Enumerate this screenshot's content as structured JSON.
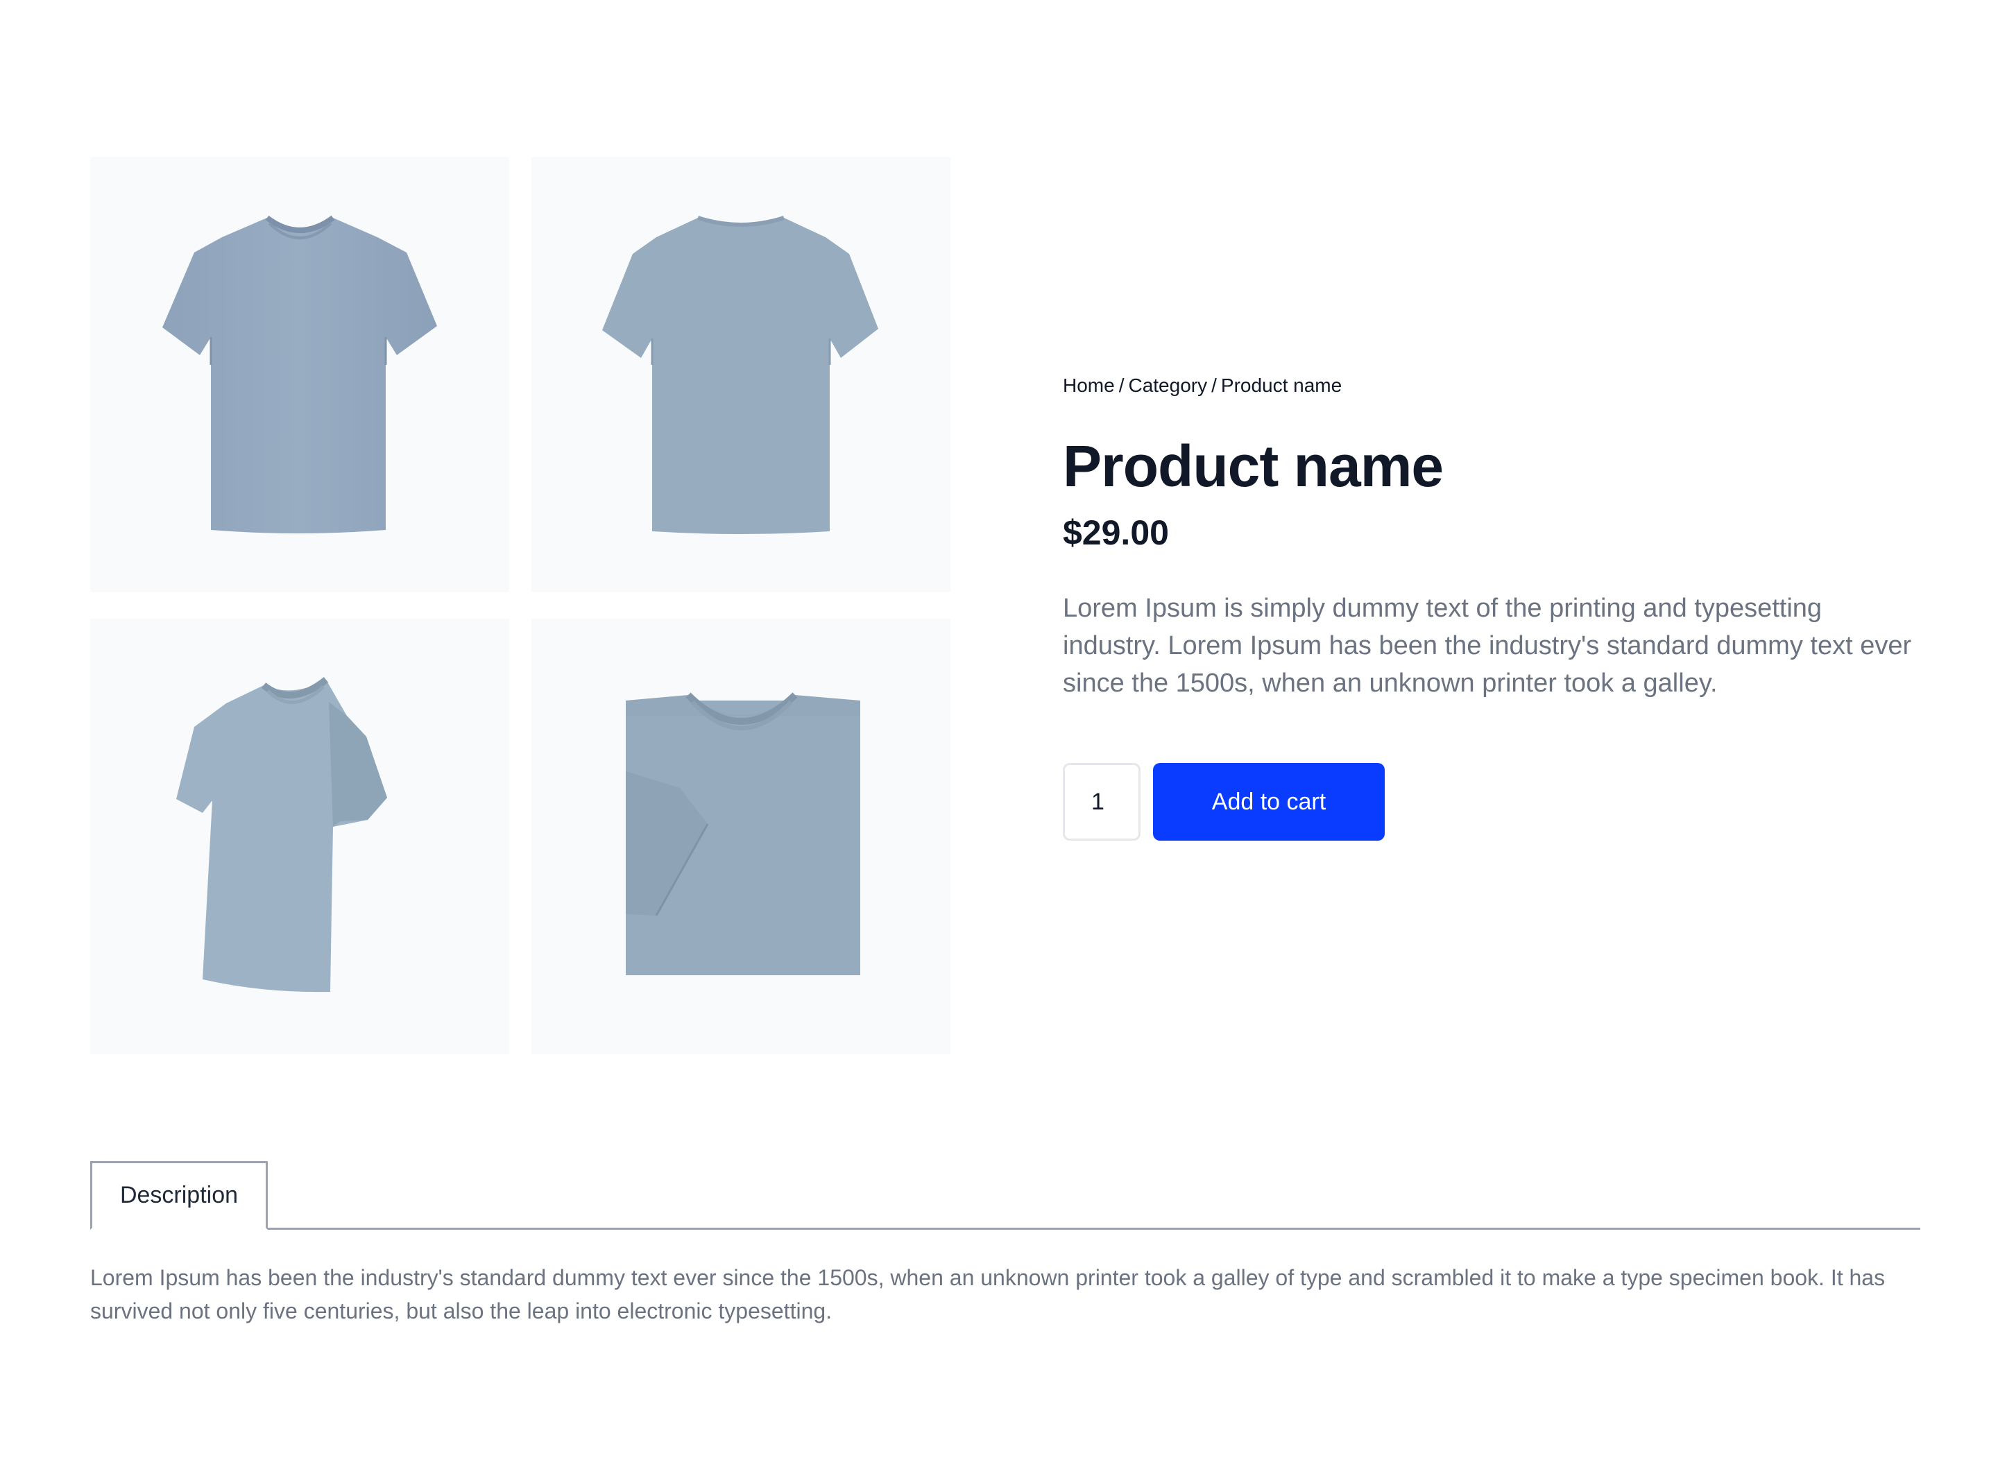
{
  "breadcrumb": {
    "home": "Home",
    "category": "Category",
    "product": "Product name",
    "separator": "/"
  },
  "product": {
    "title": "Product name",
    "price": "$29.00",
    "description": "Lorem Ipsum is simply dummy text of the printing and typesetting industry. Lorem Ipsum has been the industry's standard dummy text ever since the 1500s, when an unknown printer took a galley."
  },
  "cart": {
    "quantity": "1",
    "add_label": "Add to cart"
  },
  "gallery": {
    "images": [
      {
        "view": "front"
      },
      {
        "view": "back"
      },
      {
        "view": "angled"
      },
      {
        "view": "folded"
      }
    ]
  },
  "tabs": [
    {
      "label": "Description",
      "active": true
    }
  ],
  "tab_content": {
    "description": "Lorem Ipsum has been the industry's standard dummy text ever since the 1500s, when an unknown printer took a galley of type and scrambled it to make a type specimen book. It has survived not only five centuries, but also the leap into electronic typesetting."
  },
  "colors": {
    "accent": "#0a3cff",
    "shirt": "#94aac0",
    "thumb_bg": "#f8fafc",
    "muted_text": "#6b7280"
  }
}
